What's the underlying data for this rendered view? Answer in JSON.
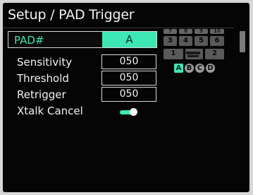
{
  "screen": {
    "title": "Setup / PAD Trigger"
  },
  "pad_select": {
    "label": "PAD#",
    "value": "A"
  },
  "params": [
    {
      "label": "Sensitivity",
      "value": "050"
    },
    {
      "label": "Threshold",
      "value": "050"
    },
    {
      "label": "Retrigger",
      "value": "050"
    },
    {
      "label": "Xtalk Cancel",
      "toggle": "on"
    }
  ],
  "kit_diagram": {
    "small_pads": [
      "7",
      "8",
      "9",
      "10"
    ],
    "big_pads_top": [
      "3",
      "4",
      "5",
      "6"
    ],
    "big_pads_bottom": [
      "1",
      "2"
    ],
    "banks": [
      "A",
      "B",
      "C",
      "D"
    ],
    "active_bank": "A"
  },
  "colors": {
    "accent": "#3ee6b4",
    "background": "#050505",
    "text": "#f2f2f2",
    "pad_gray": "#595959"
  }
}
